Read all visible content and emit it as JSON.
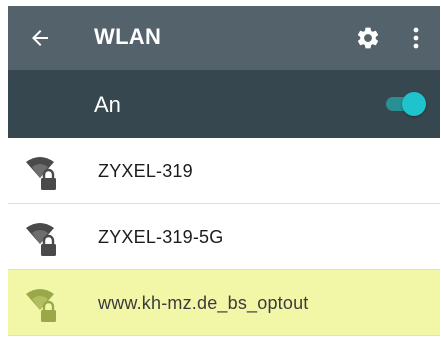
{
  "header": {
    "title": "WLAN",
    "back_icon": "arrow-left-icon",
    "settings_icon": "gear-icon",
    "more_icon": "more-vert-icon"
  },
  "wlan_toggle": {
    "label": "An",
    "on": true,
    "accent_color": "#1fc3cc"
  },
  "networks": [
    {
      "ssid": "ZYXEL-319",
      "secured": true,
      "signal": "strong",
      "highlighted": false
    },
    {
      "ssid": "ZYXEL-319-5G",
      "secured": true,
      "signal": "strong",
      "highlighted": false
    },
    {
      "ssid": "www.kh-mz.de_bs_optout",
      "secured": true,
      "signal": "strong",
      "highlighted": true
    }
  ],
  "colors": {
    "appbar": "#54626b",
    "toggle_bar": "#37474f",
    "highlight_row": "#f2f7a8"
  }
}
